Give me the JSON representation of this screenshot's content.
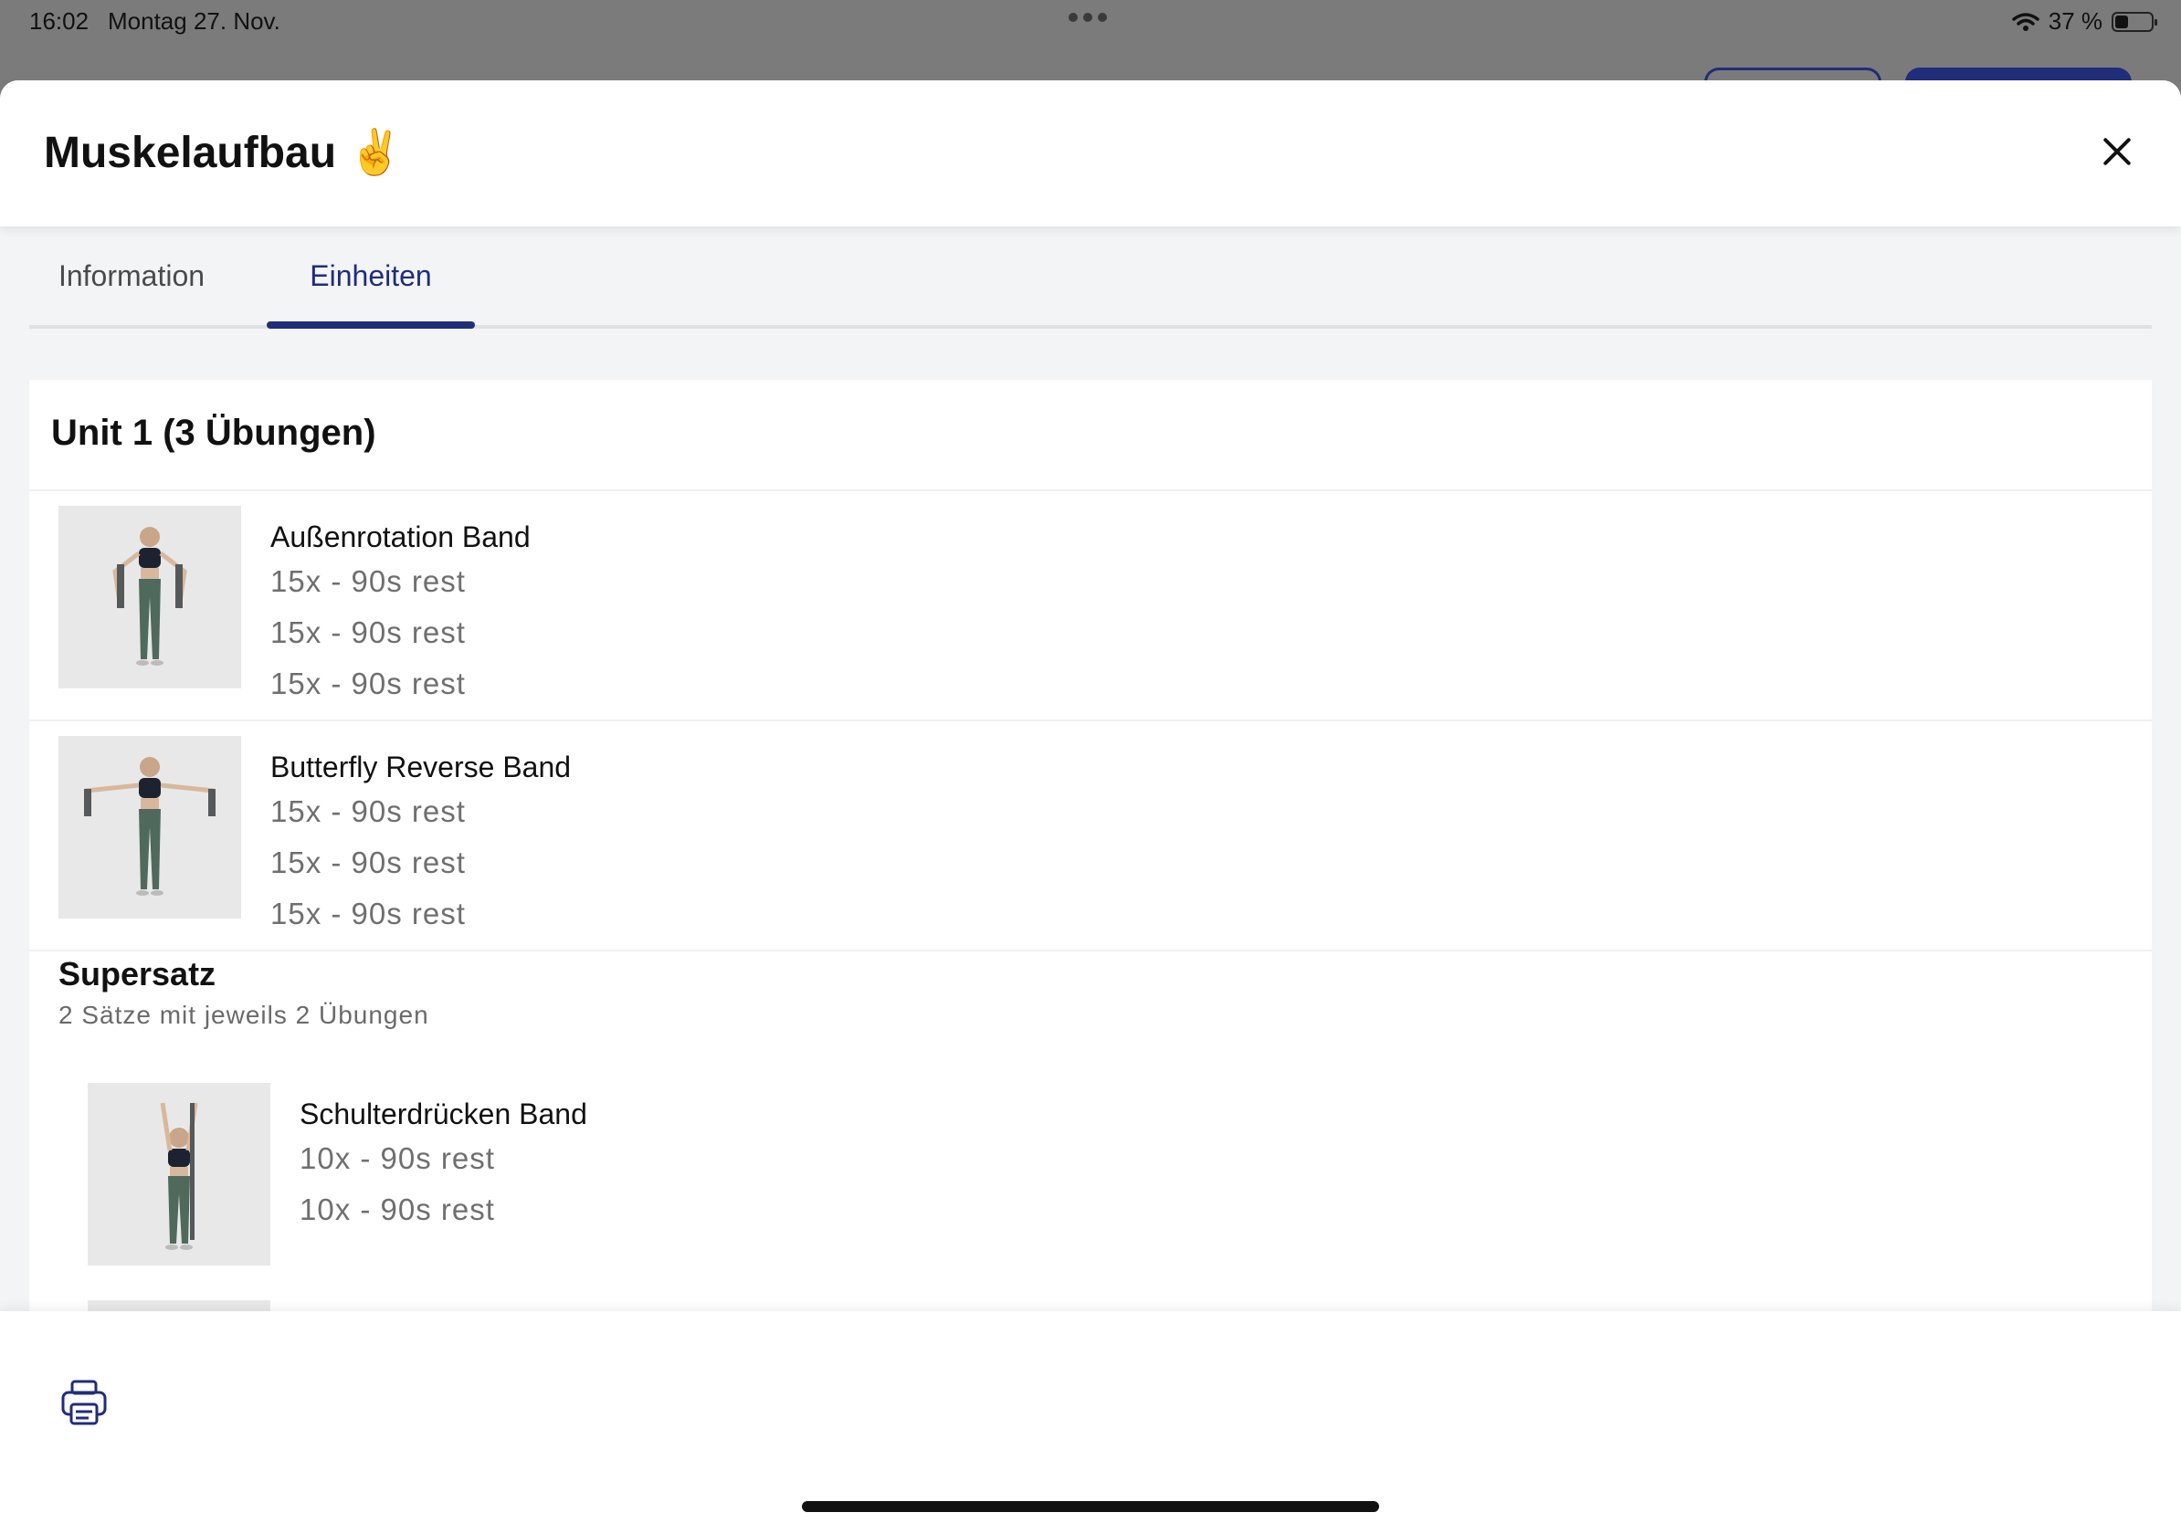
{
  "status": {
    "time": "16:02",
    "date": "Montag 27. Nov.",
    "battery": "37 %",
    "battery_level": 0.37
  },
  "sheet": {
    "title": "Muskelaufbau ✌️",
    "tabs": [
      {
        "label": "Information",
        "active": false
      },
      {
        "label": "Einheiten",
        "active": true
      }
    ]
  },
  "unit": {
    "title": "Unit 1 (3 Übungen)",
    "exercises": [
      {
        "name": "Außenrotation Band",
        "sets": [
          "15x - 90s rest",
          "15x - 90s rest",
          "15x - 90s rest"
        ]
      },
      {
        "name": "Butterfly Reverse Band",
        "sets": [
          "15x - 90s rest",
          "15x - 90s rest",
          "15x - 90s rest"
        ]
      }
    ],
    "superset": {
      "title": "Supersatz",
      "subtitle": "2 Sätze mit jeweils 2 Übungen",
      "exercises": [
        {
          "name": "Schulterdrücken Band",
          "sets": [
            "10x - 90s rest",
            "10x - 90s rest"
          ]
        }
      ]
    }
  },
  "icons": {
    "close": "close-icon",
    "print": "printer-icon",
    "wifi": "wifi-icon",
    "battery": "battery-icon"
  },
  "colors": {
    "accent": "#1f2d7a",
    "backdrop": "#7b7b7b"
  }
}
